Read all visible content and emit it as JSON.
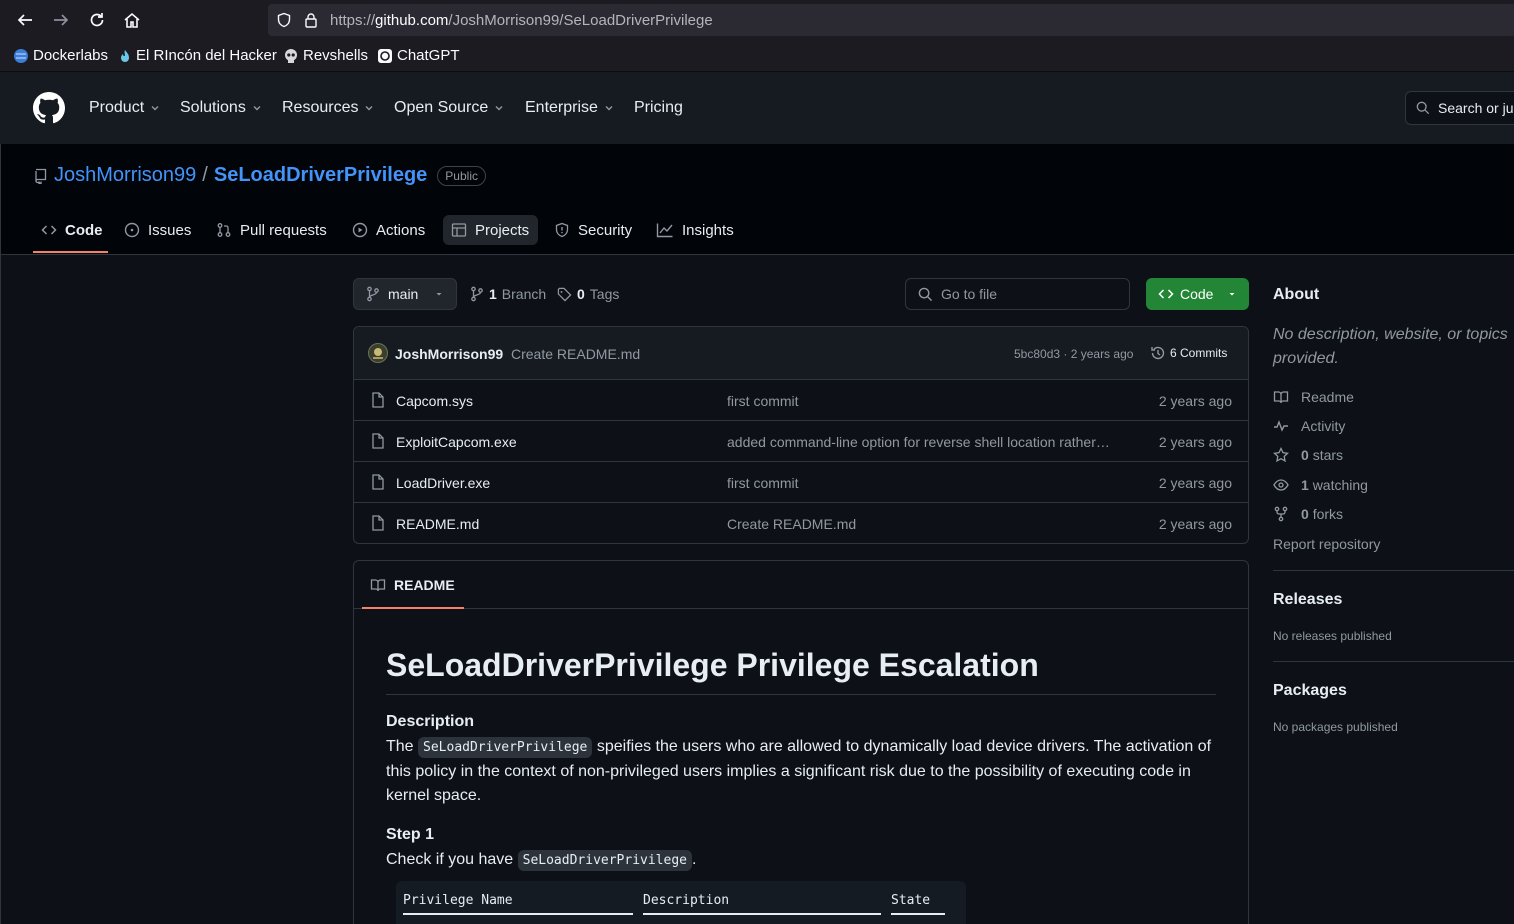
{
  "browser": {
    "url_scheme": "https://",
    "url_host": "github.com",
    "url_path": "/JoshMorrison99/SeLoadDriverPrivilege",
    "bookmarks": [
      {
        "label": "Dockerlabs",
        "icon": "globe-icon"
      },
      {
        "label": "El RIncón del Hacker",
        "icon": "flame-icon"
      },
      {
        "label": "Revshells",
        "icon": "skull-icon"
      },
      {
        "label": "ChatGPT",
        "icon": "openai-icon"
      }
    ]
  },
  "header": {
    "nav": [
      {
        "label": "Product",
        "dropdown": true
      },
      {
        "label": "Solutions",
        "dropdown": true
      },
      {
        "label": "Resources",
        "dropdown": true
      },
      {
        "label": "Open Source",
        "dropdown": true
      },
      {
        "label": "Enterprise",
        "dropdown": true
      },
      {
        "label": "Pricing",
        "dropdown": false
      }
    ],
    "search_label": "Search or ju"
  },
  "repo": {
    "owner": "JoshMorrison99",
    "separator": "/",
    "name": "SeLoadDriverPrivilege",
    "visibility": "Public",
    "tabs": [
      {
        "label": "Code",
        "icon": "code-icon",
        "active": true
      },
      {
        "label": "Issues",
        "icon": "issue-icon"
      },
      {
        "label": "Pull requests",
        "icon": "pull-request-icon"
      },
      {
        "label": "Actions",
        "icon": "play-icon"
      },
      {
        "label": "Projects",
        "icon": "table-icon"
      },
      {
        "label": "Security",
        "icon": "shield-icon"
      },
      {
        "label": "Insights",
        "icon": "graph-icon"
      }
    ]
  },
  "toolbar": {
    "branch": "main",
    "branch_count": "1",
    "branch_label": "Branch",
    "tag_count": "0",
    "tag_label": "Tags",
    "goto_placeholder": "Go to file",
    "code_button": "Code"
  },
  "commit": {
    "author": "JoshMorrison99",
    "message": "Create README.md",
    "sha_time": "5bc80d3 · 2 years ago",
    "commits_label": "6 Commits"
  },
  "files": [
    {
      "name": "Capcom.sys",
      "message": "first commit",
      "time": "2 years ago"
    },
    {
      "name": "ExploitCapcom.exe",
      "message": "added command-line option for reverse shell location rather…",
      "time": "2 years ago"
    },
    {
      "name": "LoadDriver.exe",
      "message": "first commit",
      "time": "2 years ago"
    },
    {
      "name": "README.md",
      "message": "Create README.md",
      "time": "2 years ago"
    }
  ],
  "readme": {
    "tab_label": "README",
    "h1": "SeLoadDriverPrivilege Privilege Escalation",
    "desc_heading": "Description",
    "desc_pre": "The ",
    "desc_code": "SeLoadDriverPrivilege",
    "desc_post": " speifies the users who are allowed to dynamically load device drivers. The activation of this policy in the context of non-privileged users implies a significant risk due to the possibility of executing code in kernel space.",
    "step1_heading": "Step 1",
    "step1_pre": "Check if you have ",
    "step1_code": "SeLoadDriverPrivilege",
    "step1_post": ".",
    "code_cols": [
      "Privilege Name",
      "Description",
      "State"
    ]
  },
  "sidebar": {
    "about_heading": "About",
    "about_desc": "No description, website, or topics provided.",
    "items": [
      {
        "icon": "book-icon",
        "count": "",
        "label": "Readme"
      },
      {
        "icon": "pulse-icon",
        "count": "",
        "label": "Activity"
      },
      {
        "icon": "star-icon",
        "count": "0",
        "label": "stars"
      },
      {
        "icon": "eye-icon",
        "count": "1",
        "label": "watching"
      },
      {
        "icon": "fork-icon",
        "count": "0",
        "label": "forks"
      }
    ],
    "report": "Report repository",
    "releases_heading": "Releases",
    "releases_text": "No releases published",
    "packages_heading": "Packages",
    "packages_text": "No packages published"
  }
}
